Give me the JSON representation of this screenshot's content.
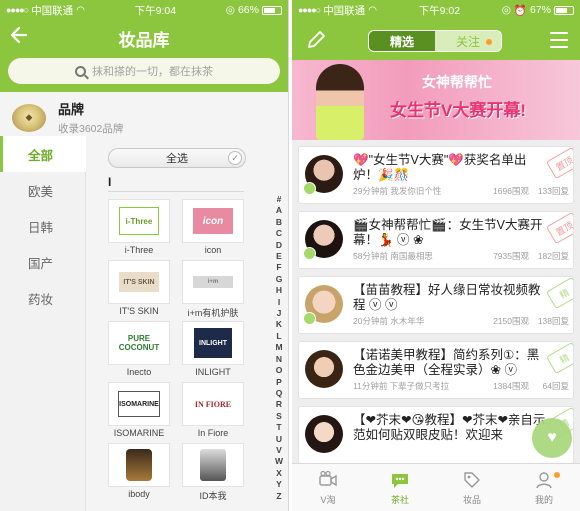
{
  "left": {
    "status": {
      "carrier": "中国联通",
      "time": "下午9:04",
      "battery": "66%",
      "battery_level": 0.66
    },
    "nav": {
      "back_icon": "back-arrow-icon",
      "title": "妆品库"
    },
    "search": {
      "placeholder": "抹和搽的一切，都在抹茶"
    },
    "brand_header": {
      "title": "品牌",
      "count": "收录3602品牌"
    },
    "categories": [
      "全部",
      "欧美",
      "日韩",
      "国产",
      "药妆"
    ],
    "active_category": "全部",
    "select_all": "全选",
    "section_letter": "I",
    "brands": [
      {
        "name": "i-Three",
        "logo": "i-Three"
      },
      {
        "name": "icon",
        "logo": "icon"
      },
      {
        "name": "IT'S SKIN",
        "logo": "IT'S SKIN"
      },
      {
        "name": "i+m有机护肤",
        "logo": "i+m"
      },
      {
        "name": "Inecto",
        "logo": "PURE COCONUT"
      },
      {
        "name": "INLIGHT",
        "logo": "INLIGHT"
      },
      {
        "name": "ISOMARINE",
        "logo": "ISOMARINE"
      },
      {
        "name": "In Fiore",
        "logo": "IN FIORE"
      },
      {
        "name": "ibody",
        "logo": ""
      },
      {
        "name": "ID本我",
        "logo": ""
      }
    ],
    "alphabet": [
      "#",
      "A",
      "B",
      "C",
      "D",
      "E",
      "F",
      "G",
      "H",
      "I",
      "J",
      "K",
      "L",
      "M",
      "N",
      "O",
      "P",
      "Q",
      "R",
      "S",
      "T",
      "U",
      "V",
      "W",
      "X",
      "Y",
      "Z"
    ]
  },
  "right": {
    "status": {
      "carrier": "中国联通",
      "time": "下午9:02",
      "battery": "67%",
      "battery_level": 0.67
    },
    "segments": {
      "selected": "精选",
      "other": "关注"
    },
    "banner": {
      "line1": "女神帮帮忙",
      "line2": "女生节V大赛开幕!"
    },
    "posts": [
      {
        "title": "💖\"女生节V大赛\"💖获奖名单出炉！🎉🎊",
        "time": "29分钟前 我发你旧个性",
        "views": "1696围观",
        "replies": "133回复",
        "pin": "置顶",
        "pin_color": "#f29a9a"
      },
      {
        "title": "🎬女神帮帮忙🎬：女生节V大赛开幕！💃 ⓥ ❀",
        "time": "58分钟前 南国最相思",
        "views": "7935围观",
        "replies": "182回复",
        "pin": "置顶",
        "pin_color": "#f29a9a"
      },
      {
        "title": "【苗苗教程】好人缘日常妆视频教程 ⓥ ⓥ",
        "time": "20分钟前 水木年华",
        "views": "2150围观",
        "replies": "138回复",
        "pin": "精",
        "pin_color": "#b5dc8a"
      },
      {
        "title": "【诺诺美甲教程】简约系列①：黑色金边美甲（全程实录）❀ ⓥ",
        "time": "11分钟前 下辈子做只考拉",
        "views": "1384围观",
        "replies": "64回复",
        "pin": "精",
        "pin_color": "#b5dc8a"
      },
      {
        "title": "【❤芥末❤😘教程】❤芥末❤亲自示范如何贴双眼皮贴！欢迎来",
        "time": "",
        "views": "",
        "replies": "",
        "pin": "精",
        "pin_color": "#b5dc8a"
      }
    ],
    "tabs": [
      {
        "label": "V淘",
        "icon": "video-icon"
      },
      {
        "label": "茶社",
        "icon": "chat-bubble-icon"
      },
      {
        "label": "妆品",
        "icon": "tag-icon"
      },
      {
        "label": "我的",
        "icon": "person-icon"
      }
    ],
    "active_tab": "茶社"
  },
  "colors": {
    "brand_green": "#8cc63f",
    "dark_green": "#5a8f22",
    "pink": "#e8336f",
    "badge_orange": "#ff9c2a"
  }
}
